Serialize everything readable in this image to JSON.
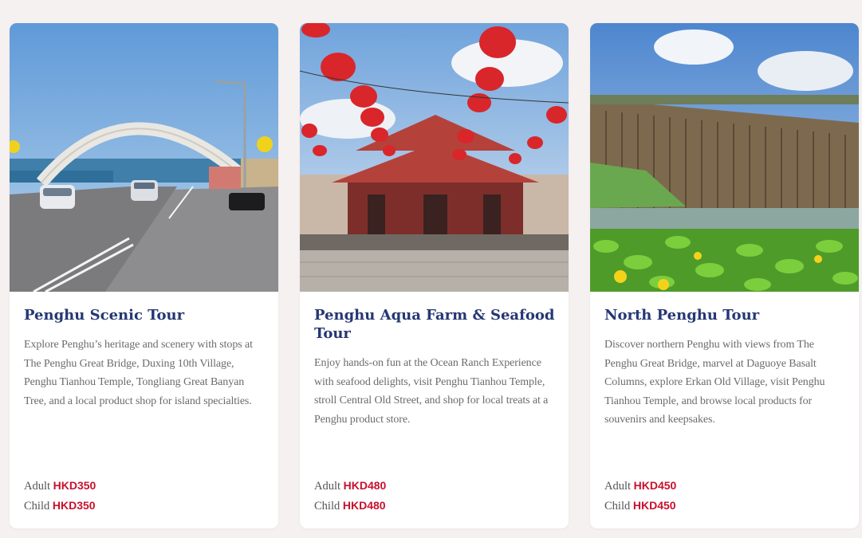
{
  "colors": {
    "title": "#253774",
    "price": "#c8102e",
    "body_text": "#6b6b6b",
    "page_bg": "#f6f1f1"
  },
  "tours": [
    {
      "title": "Penghu Scenic Tour",
      "image": "arch-bridge-photo",
      "description": "Explore Penghu’s heritage and scenery with stops at The Penghu Great Bridge, Duxing 10th Village, Penghu Tianhou Temple, Tongliang Great Banyan Tree, and a local product shop for island specialties.",
      "adult_label": "Adult",
      "adult_price": "HKD350",
      "child_label": "Child",
      "child_price": "HKD350"
    },
    {
      "title": "Penghu Aqua Farm & Seafood Tour",
      "image": "temple-lanterns-photo",
      "description": "Enjoy hands-on fun at the Ocean Ranch Experience with seafood delights, visit Penghu Tianhou Temple, stroll Central Old Street, and shop for local treats at a Penghu product store.",
      "adult_label": "Adult",
      "adult_price": "HKD480",
      "child_label": "Child",
      "child_price": "HKD480"
    },
    {
      "title": "North Penghu Tour",
      "image": "basalt-columns-photo",
      "description": "Discover northern Penghu with views from The Penghu Great Bridge, marvel at Daguoye Basalt Columns, explore Erkan Old Village, visit Penghu Tianhou Temple, and browse local products for souvenirs and keepsakes.",
      "adult_label": "Adult",
      "adult_price": "HKD450",
      "child_label": "Child",
      "child_price": "HKD450"
    }
  ]
}
